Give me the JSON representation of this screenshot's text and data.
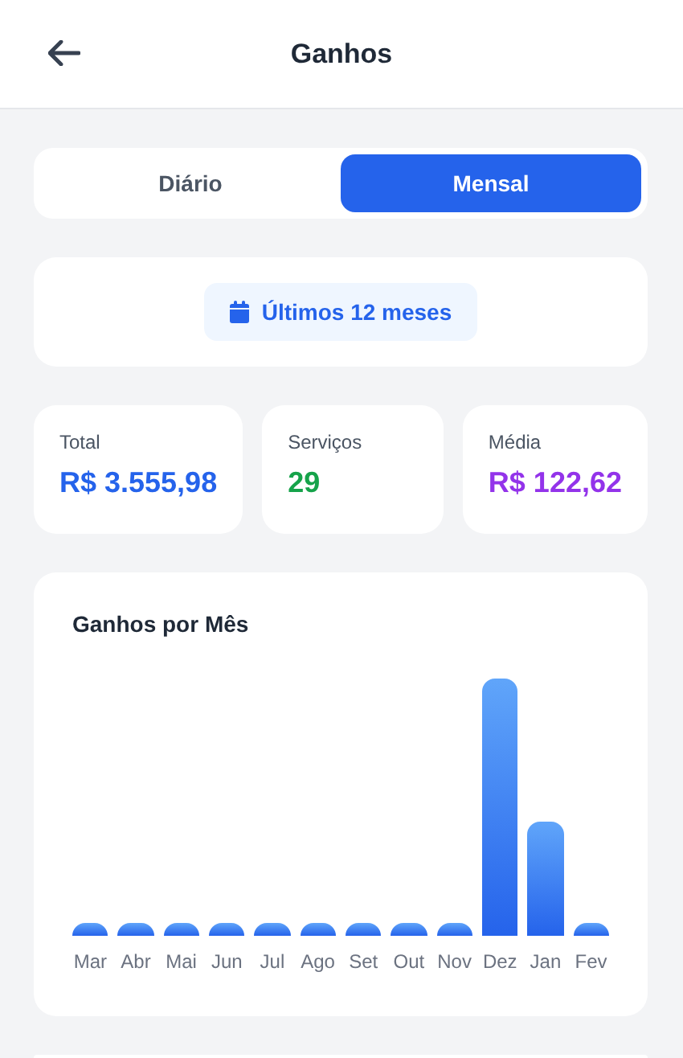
{
  "header": {
    "title": "Ganhos"
  },
  "tabs": [
    {
      "label": "Diário",
      "selected": false
    },
    {
      "label": "Mensal",
      "selected": true
    }
  ],
  "period_filter": {
    "label": "Últimos 12 meses"
  },
  "stats": [
    {
      "label": "Total",
      "value": "R$ 3.555,98",
      "color": "#2563eb"
    },
    {
      "label": "Serviços",
      "value": "29",
      "color": "#16a34a"
    },
    {
      "label": "Média",
      "value": "R$ 122,62",
      "color": "#9333ea"
    }
  ],
  "chart": {
    "title": "Ganhos por Mês",
    "months": [
      "Mar",
      "Abr",
      "Mai",
      "Jun",
      "Jul",
      "Ago",
      "Set",
      "Out",
      "Nov",
      "Dez",
      "Jan",
      "Fev"
    ]
  }
}
